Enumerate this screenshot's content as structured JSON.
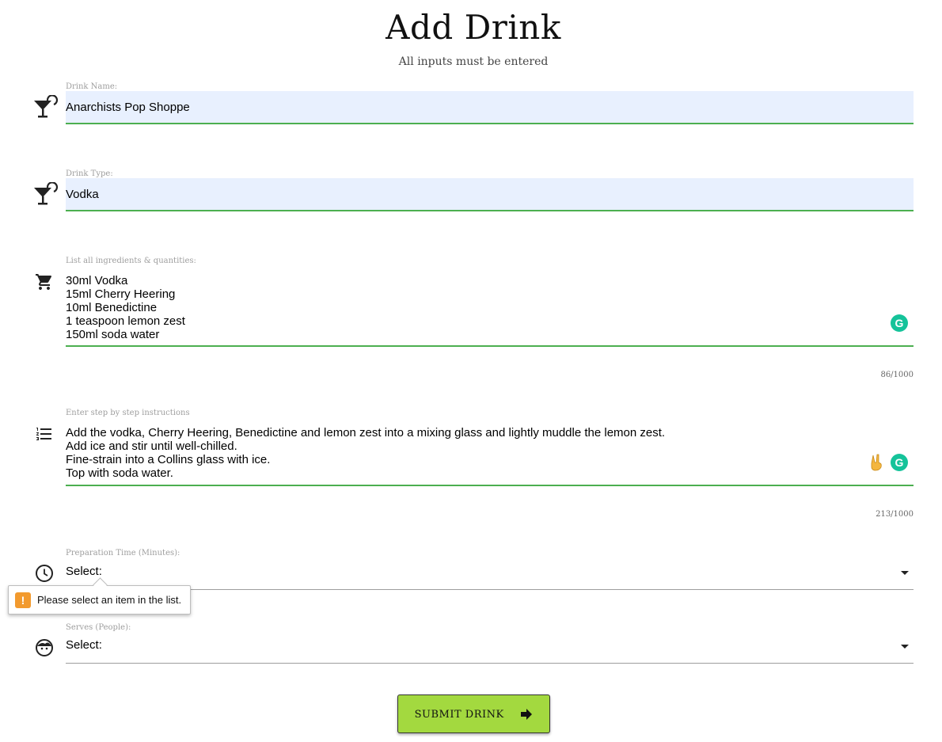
{
  "header": {
    "title": "Add Drink",
    "subtitle": "All inputs must be entered"
  },
  "fields": {
    "drink_name": {
      "label": "Drink Name:",
      "value": "Anarchists Pop Shoppe",
      "icon": "cocktail-icon"
    },
    "drink_type": {
      "label": "Drink Type:",
      "value": "Vodka",
      "icon": "cocktail-icon"
    },
    "ingredients": {
      "label": "List all ingredients & quantities:",
      "value": "30ml Vodka\n15ml Cherry Heering\n10ml Benedictine\n1 teaspoon lemon zest\n150ml soda water",
      "counter": "86/1000",
      "icon": "cart-icon"
    },
    "instructions": {
      "label": "Enter step by step instructions",
      "value": "Add the vodka, Cherry Heering, Benedictine and lemon zest into a mixing glass and lightly muddle the lemon zest.\nAdd ice and stir until well-chilled.\nFine-strain into a Collins glass with ice.\nTop with soda water.",
      "counter": "213/1000",
      "icon": "numbered-list-icon"
    },
    "prep_time": {
      "label": "Preparation Time (Minutes):",
      "value": "Select:",
      "icon": "clock-icon"
    },
    "serves": {
      "label": "Serves (People):",
      "value": "Select:",
      "icon": "face-icon"
    }
  },
  "validation_tooltip": {
    "text": "Please select an item in the list.",
    "icon": "warning-icon"
  },
  "submit": {
    "label": "SUBMIT DRINK",
    "icon": "arrow-right-icon"
  },
  "colors": {
    "accent_green": "#4caf50",
    "button_bg": "#a3d93f",
    "autofill_bg": "#e8f0fe",
    "grammarly": "#15c39a",
    "warning": "#f29a2e"
  }
}
